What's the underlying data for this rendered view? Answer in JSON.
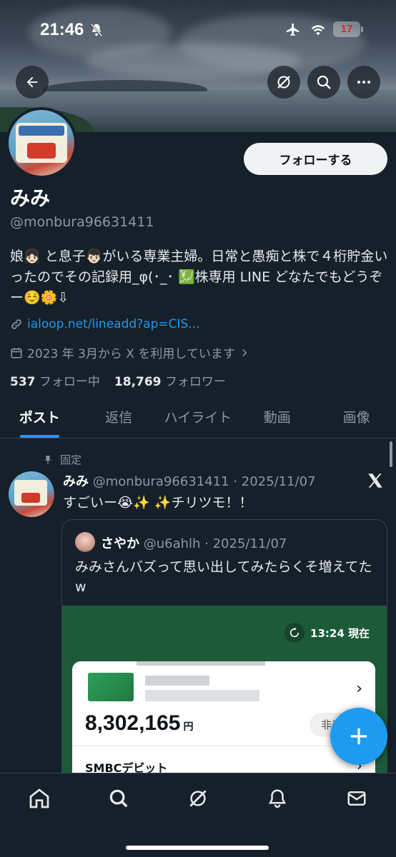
{
  "status_bar": {
    "time": "21:46",
    "battery": "17"
  },
  "profile": {
    "name": "みみ",
    "handle": "@monbura96631411",
    "bio": "娘👧🏻 と息子👦🏻がいる専業主婦。日常と愚痴と株で４桁貯金いったのでその記録用_φ(･_･ 💹株専用 LINE どなたでもどうぞー☺️🌼⇩",
    "link": "ialoop.net/lineadd?ap=CIS...",
    "joined": "2023 年 3月から X を利用しています",
    "following_count": "537",
    "following_label": "フォロー中",
    "followers_count": "18,769",
    "followers_label": "フォロワー",
    "follow_button": "フォローする"
  },
  "tabs": [
    {
      "label": "ポスト",
      "active": true
    },
    {
      "label": "返信"
    },
    {
      "label": "ハイライト"
    },
    {
      "label": "動画"
    },
    {
      "label": "画像"
    }
  ],
  "post": {
    "pinned_label": "固定",
    "author_name": "みみ",
    "author_meta": "@monbura96631411 · 2025/11/07",
    "text": "すごいー😭✨ ✨チリツモ！！",
    "quote": {
      "author_name": "さやか",
      "author_meta": "@u6ahlh · 2025/11/07",
      "text": "みみさんバズって思い出してみたらくそ増えてたw",
      "image": {
        "time": "13:24 現在",
        "amount": "8,302,165",
        "currency": "円",
        "pill": "非表",
        "debit_label": "SMBCデビット"
      }
    }
  },
  "icons": [
    "back-icon",
    "grok-icon",
    "search-icon",
    "more-icon",
    "home-icon",
    "notifications-icon",
    "messages-icon",
    "compose-icon"
  ],
  "colors": {
    "background": "#15202b",
    "accent": "#1d9bf0",
    "muted": "#8b98a5"
  }
}
